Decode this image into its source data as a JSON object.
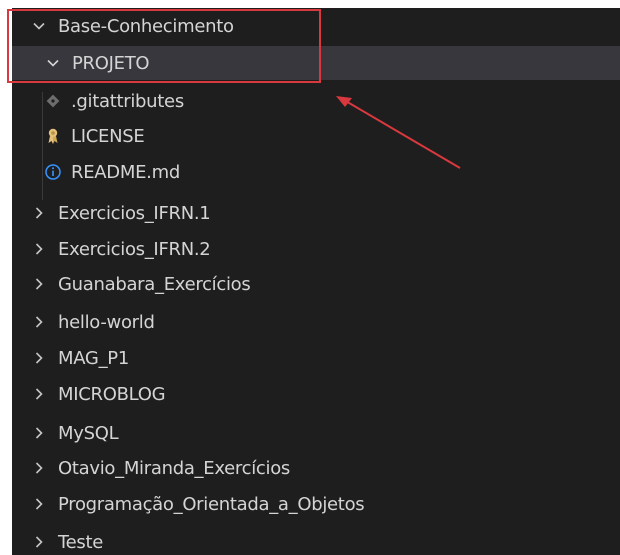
{
  "explorer": {
    "root": {
      "label": "Base-Conhecimento",
      "expanded": true
    },
    "project": {
      "label": "PROJETO",
      "expanded": true,
      "selected": true
    },
    "files": [
      {
        "label": ".gitattributes",
        "icon": "git-diamond-icon"
      },
      {
        "label": "LICENSE",
        "icon": "license-ribbon-icon"
      },
      {
        "label": "README.md",
        "icon": "info-icon"
      }
    ],
    "folders": [
      {
        "label": "Exercicios_IFRN.1"
      },
      {
        "label": "Exercicios_IFRN.2"
      },
      {
        "label": "Guanabara_Exercícios"
      },
      {
        "label": "hello-world"
      },
      {
        "label": "MAG_P1"
      },
      {
        "label": "MICROBLOG"
      },
      {
        "label": "MySQL"
      },
      {
        "label": "Otavio_Miranda_Exercícios"
      },
      {
        "label": "Programação_Orientada_a_Objetos"
      },
      {
        "label": "Teste"
      }
    ]
  },
  "colors": {
    "background": "#1e1e1e",
    "selected_row": "#37373d",
    "text": "#d4d4d4",
    "annotation": "#d9393e",
    "info_icon": "#3794ff",
    "license_icon": "#e5c07b"
  }
}
